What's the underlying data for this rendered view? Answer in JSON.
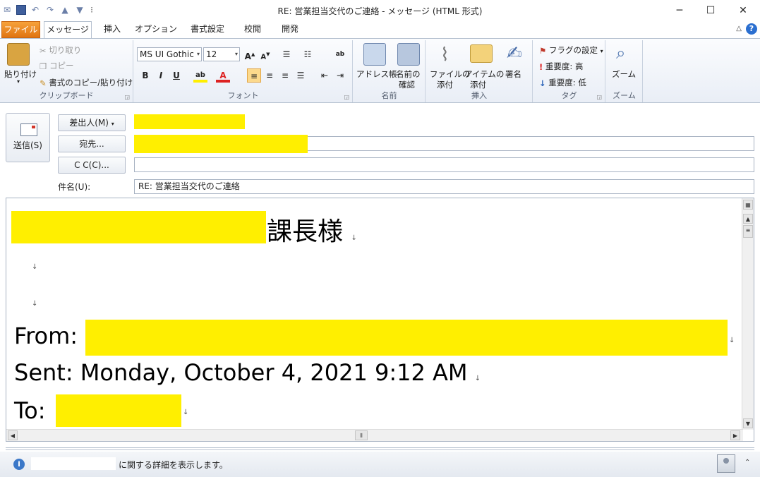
{
  "window": {
    "title": "RE: 営業担当交代のご連絡 - メッセージ (HTML 形式)",
    "minimize": "─",
    "maximize": "☐",
    "close": "✕"
  },
  "tabs": [
    {
      "label": "ファイル"
    },
    {
      "label": "メッセージ"
    },
    {
      "label": "挿入"
    },
    {
      "label": "オプション"
    },
    {
      "label": "書式設定"
    },
    {
      "label": "校閲"
    },
    {
      "label": "開発"
    }
  ],
  "ribbon": {
    "clipboard": {
      "group_label": "クリップボード",
      "paste": "貼り付け",
      "cut": "切り取り",
      "copy": "コピー",
      "format_painter": "書式のコピー/貼り付け"
    },
    "font": {
      "group_label": "フォント",
      "font_name": "MS UI Gothic",
      "font_size": "12"
    },
    "names": {
      "group_label": "名前",
      "address_book": "アドレス帳",
      "check_names_1": "名前の",
      "check_names_2": "確認"
    },
    "insert": {
      "group_label": "挿入",
      "attach_file_1": "ファイルの",
      "attach_file_2": "添付",
      "attach_item_1": "アイテムの",
      "attach_item_2": "添付",
      "signature": "署名"
    },
    "tags": {
      "group_label": "タグ",
      "follow_up": "フラグの設定",
      "high_importance": "重要度: 高",
      "low_importance": "重要度: 低"
    },
    "zoom": {
      "group_label": "ズーム",
      "zoom": "ズーム"
    }
  },
  "compose": {
    "send": "送信(S)",
    "from_button": "差出人(M)",
    "to_button": "宛先...",
    "cc_button": "C C(C)...",
    "subject_label": "件名(U):",
    "subject_value": "RE: 営業担当交代のご連絡"
  },
  "body": {
    "greeting": "課長様",
    "from_label": "From:",
    "sent_line": "Sent: Monday, October 4, 2021 9:12 AM",
    "to_label": "To:"
  },
  "status": {
    "details_text": "に関する詳細を表示します。"
  },
  "colors": {
    "highlight": "#ffef00",
    "file_tab": "#e8821f",
    "accent": "#3f5f9c"
  }
}
